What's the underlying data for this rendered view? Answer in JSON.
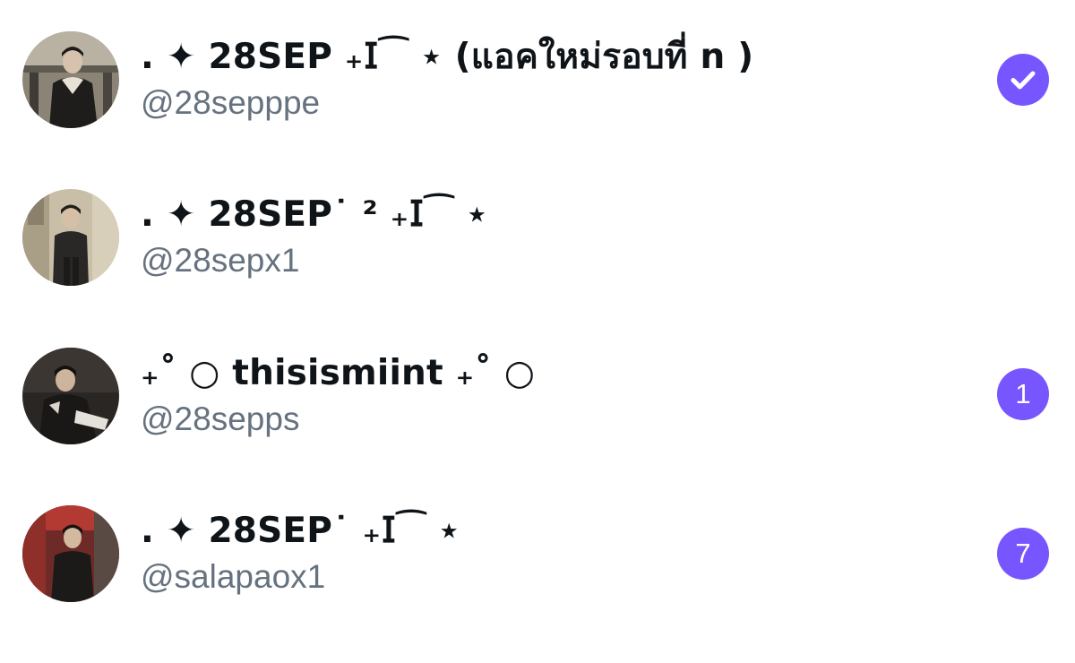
{
  "colors": {
    "accent": "#7856ff",
    "name_text": "#0f1419",
    "handle_text": "#66727f",
    "background": "#ffffff"
  },
  "accounts": [
    {
      "display_name": ". ✦ 28SEP ₊𝖨⁀ ⋆ (แอคใหม่รอบที่ n )",
      "handle": "@28sepppe",
      "selected": true,
      "badge_icon": "check-icon",
      "avatar_icon": "user-photo"
    },
    {
      "display_name": ". ✦ 28SEP˙ ² ₊𝖨⁀ ⋆",
      "handle": "@28sepx1",
      "avatar_icon": "user-photo"
    },
    {
      "display_name": "₊˚ ○ thisismiint ₊˚ ○",
      "handle": "@28sepps",
      "unread": "1",
      "avatar_icon": "user-photo"
    },
    {
      "display_name": ". ✦ 28SEP˙ ₊𝖨⁀ ⋆",
      "handle": "@salapaox1",
      "unread": "7",
      "avatar_icon": "user-photo"
    }
  ]
}
